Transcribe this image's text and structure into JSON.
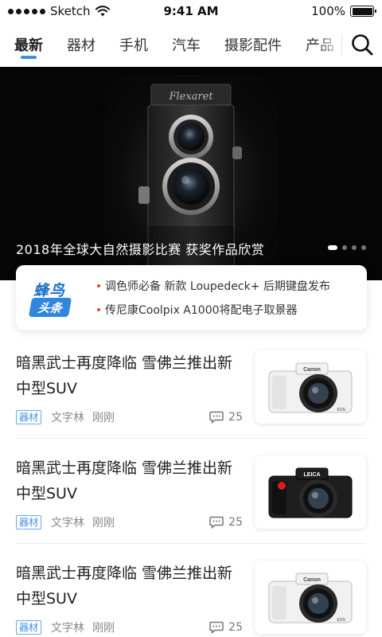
{
  "status_bar": {
    "carrier": "Sketch",
    "time": "9:41 AM",
    "battery": "100%",
    "battery_level": 1.0,
    "signal_icon": "signal-dots-icon",
    "wifi_icon": "wifi-icon",
    "battery_icon": "battery-icon"
  },
  "tabs": [
    {
      "label": "最新",
      "active": true
    },
    {
      "label": "器材",
      "active": false
    },
    {
      "label": "手机",
      "active": false
    },
    {
      "label": "汽车",
      "active": false
    },
    {
      "label": "摄影配件",
      "active": false
    },
    {
      "label": "产品",
      "active": false
    }
  ],
  "search": {
    "icon": "search-icon"
  },
  "hero": {
    "caption": "2018年全球大自然摄影比赛 获奖作品欣赏",
    "camera_brand": "Flexaret",
    "slide_count": 4,
    "active_slide": 1
  },
  "news": {
    "brand_top": "蜂鸟",
    "brand_bottom": "头条",
    "items": [
      "调色师必备 新款 Loupedeck+ 后期键盘发布",
      "传尼康Coolpix A1000将配电子取景器"
    ]
  },
  "articles": [
    {
      "title": "暗黑武士再度降临 雪佛兰推出新中型SUV",
      "tag": "器材",
      "author": "文字林",
      "time": "刚刚",
      "comments": "25",
      "camera_label": "Canon",
      "camera_badge": "EOS",
      "camera_color": "light"
    },
    {
      "title": "暗黑武士再度降临 雪佛兰推出新中型SUV",
      "tag": "器材",
      "author": "文字林",
      "time": "刚刚",
      "comments": "25",
      "camera_label": "LEICA",
      "camera_badge": "",
      "camera_color": "dark"
    },
    {
      "title": "暗黑武士再度降临 雪佛兰推出新中型SUV",
      "tag": "器材",
      "author": "文字林",
      "time": "刚刚",
      "comments": "25",
      "camera_label": "Canon",
      "camera_badge": "EOS",
      "camera_color": "light"
    }
  ],
  "colors": {
    "accent": "#3b8fe3",
    "bullet": "#e0443a",
    "brand_blue": "#2f86dc"
  }
}
